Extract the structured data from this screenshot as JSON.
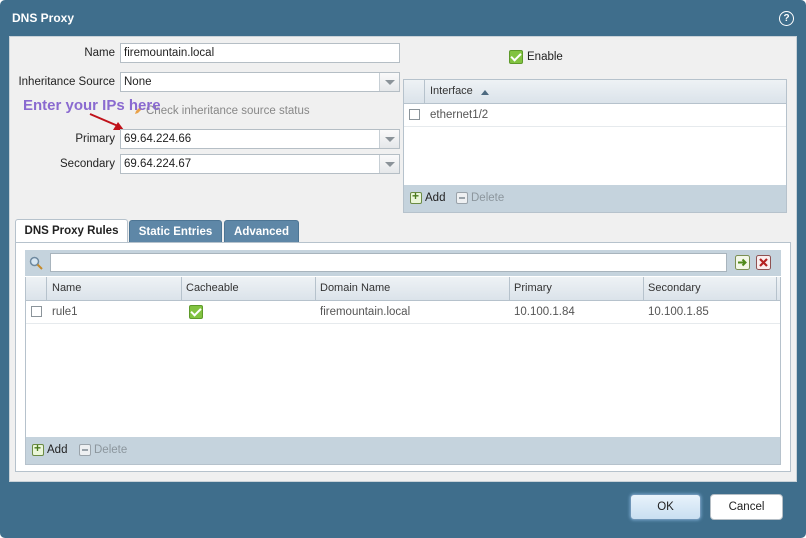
{
  "dialog": {
    "title": "DNS Proxy",
    "help_icon": "help-icon"
  },
  "form": {
    "name_label": "Name",
    "name_value": "firemountain.local",
    "inheritance_label": "Inheritance Source",
    "inheritance_value": "None",
    "check_status_label": "Check inheritance source status",
    "primary_label": "Primary",
    "primary_value": "69.64.224.66",
    "secondary_label": "Secondary",
    "secondary_value": "69.64.224.67",
    "enable_label": "Enable",
    "enable_checked": true
  },
  "annotation": {
    "text": "Enter your IPs here",
    "color": "#8a6ad0",
    "arrow_color": "#c0121a"
  },
  "interface_grid": {
    "header": "Interface",
    "rows": [
      {
        "interface": "ethernet1/2"
      }
    ],
    "add_label": "Add",
    "delete_label": "Delete"
  },
  "tabs": [
    {
      "label": "DNS Proxy Rules",
      "active": true
    },
    {
      "label": "Static Entries",
      "active": false
    },
    {
      "label": "Advanced",
      "active": false
    }
  ],
  "rules_grid": {
    "search_placeholder": "",
    "columns": [
      "Name",
      "Cacheable",
      "Domain Name",
      "Primary",
      "Secondary"
    ],
    "rows": [
      {
        "name": "rule1",
        "cacheable": true,
        "domain": "firemountain.local",
        "primary": "10.100.1.84",
        "secondary": "10.100.1.85"
      }
    ],
    "add_label": "Add",
    "delete_label": "Delete"
  },
  "buttons": {
    "ok": "OK",
    "cancel": "Cancel"
  },
  "colors": {
    "titlebar": "#3f6e8c",
    "accent_green": "#82c341",
    "tab_inactive": "#5e87a7"
  }
}
